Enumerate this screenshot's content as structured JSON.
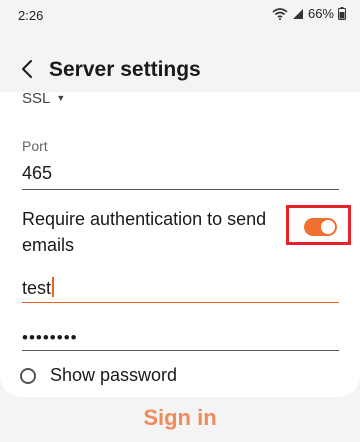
{
  "status_bar": {
    "time": "2:26",
    "battery": "66%",
    "icons": [
      "wifi-icon",
      "signal-icon",
      "battery-icon"
    ]
  },
  "header": {
    "title": "Server settings",
    "back_icon": "chevron-left-icon"
  },
  "form": {
    "security_type": "SSL",
    "port_label": "Port",
    "port_value": "465",
    "auth_label": "Require authentication to send emails",
    "auth_enabled": true,
    "username_value": "test",
    "password_value": "••••••••",
    "show_password_label": "Show password",
    "show_password_checked": false
  },
  "footer": {
    "sign_in_label": "Sign in"
  },
  "colors": {
    "accent": "#f2702f",
    "highlight": "#e8202a",
    "sign_in": "#f08a5a"
  }
}
